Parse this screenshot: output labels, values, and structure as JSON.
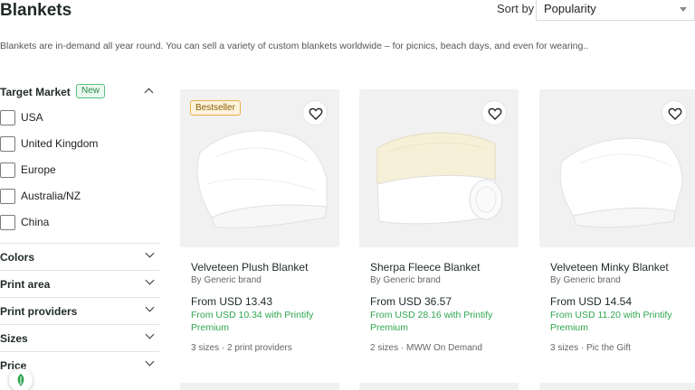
{
  "header": {
    "title": "Blankets",
    "sort_label": "Sort by",
    "sort_value": "Popularity"
  },
  "intro": "Blankets are in-demand all year round. You can sell a variety of custom blankets worldwide – for picnics, beach days, and even for wearing..",
  "sidebar": {
    "target_market": {
      "title": "Target Market",
      "badge": "New",
      "options": [
        "USA",
        "United Kingdom",
        "Europe",
        "Australia/NZ",
        "China"
      ]
    },
    "filters": [
      "Colors",
      "Print area",
      "Print providers",
      "Sizes",
      "Price"
    ]
  },
  "products": [
    {
      "title": "Velveteen Plush Blanket",
      "brand": "By Generic brand",
      "price": "From USD 13.43",
      "premium": "From USD 10.34 with Printify Premium",
      "meta": "3 sizes · 2 print providers",
      "badge": "Bestseller"
    },
    {
      "title": "Sherpa Fleece Blanket",
      "brand": "By Generic brand",
      "price": "From USD 36.57",
      "premium": "From USD 28.16 with Printify Premium",
      "meta": "2 sizes · MWW On Demand"
    },
    {
      "title": "Velveteen Minky Blanket",
      "brand": "By Generic brand",
      "price": "From USD 14.54",
      "premium": "From USD 11.20 with Printify Premium",
      "meta": "3 sizes · Pic the Gift"
    }
  ],
  "colors": {
    "premium_green": "#2fa650",
    "badge_green": "#2a8a49",
    "bestseller_orange": "#e8b04c"
  }
}
